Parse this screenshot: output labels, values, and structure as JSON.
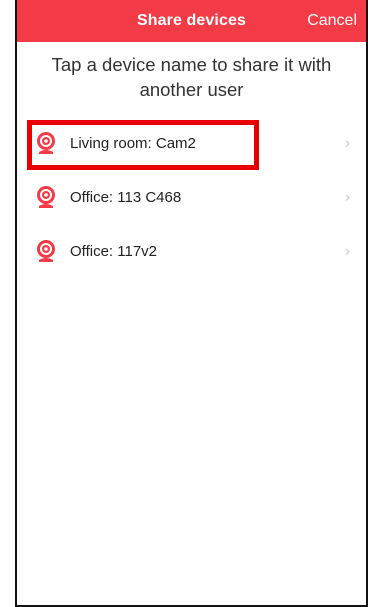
{
  "header": {
    "title": "Share devices",
    "cancel_label": "Cancel"
  },
  "instructions": "Tap a device name to share it with\nanother user",
  "devices": [
    {
      "label": "Living room: Cam2",
      "icon": "webcam-icon"
    },
    {
      "label": "Office: 113 C468",
      "icon": "webcam-icon"
    },
    {
      "label": "Office: 117v2",
      "icon": "webcam-icon"
    }
  ],
  "colors": {
    "accent": "#f23b46",
    "highlight": "#e80000",
    "chevron": "#c7c7cc"
  }
}
